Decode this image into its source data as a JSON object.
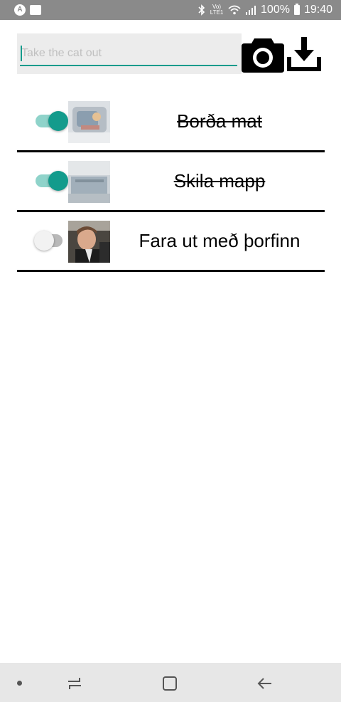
{
  "status_bar": {
    "battery": "100%",
    "time": "19:40",
    "left_icons": [
      "app-a-icon",
      "outlook-icon"
    ],
    "right_icons": [
      "bluetooth-icon",
      "volte-icon",
      "wifi-icon",
      "signal-icon",
      "battery-icon"
    ],
    "volte_text": "Vo) LTE1"
  },
  "input": {
    "placeholder": "Take the cat out",
    "value": ""
  },
  "actions": {
    "camera_icon": "camera-icon",
    "download_icon": "download-icon"
  },
  "tasks": [
    {
      "label": "Borða mat",
      "completed": true
    },
    {
      "label": "Skila mapp",
      "completed": true
    },
    {
      "label": "Fara ut með þorfinn",
      "completed": false
    }
  ],
  "nav_bar": {
    "icons": [
      "recent-apps-icon",
      "home-icon",
      "back-icon"
    ]
  },
  "colors": {
    "accent": "#139b8c",
    "accent_light": "#8fd3ca",
    "status_bar": "#8a8a8a",
    "input_bg": "#ececec",
    "nav_bar": "#e7e7e7"
  }
}
